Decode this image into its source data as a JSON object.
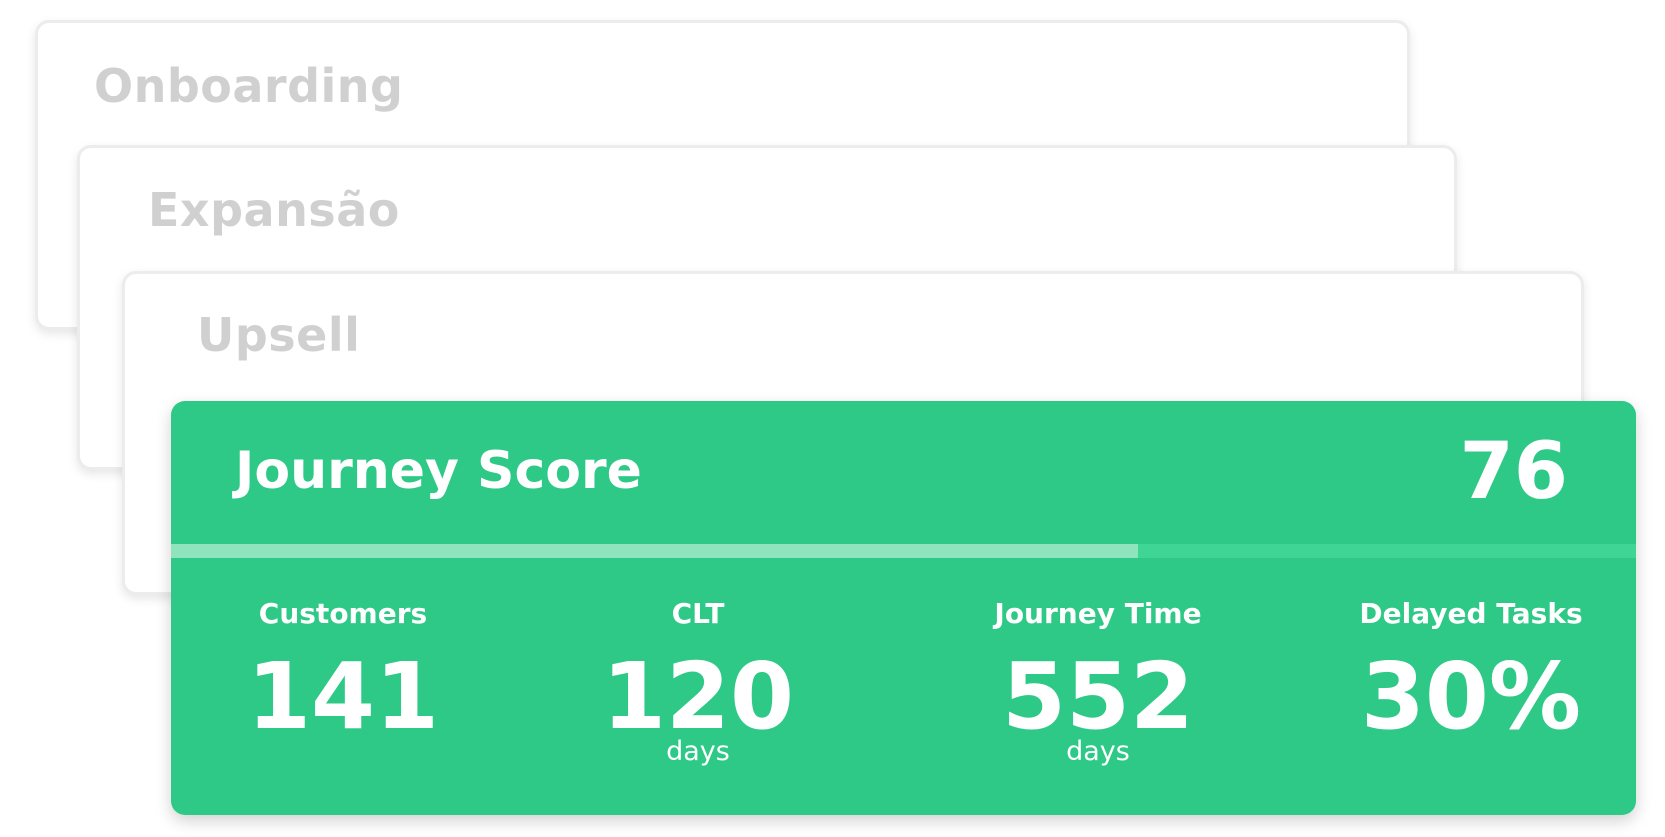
{
  "stack": {
    "cards": [
      {
        "title": "Onboarding"
      },
      {
        "title": "Expansão"
      },
      {
        "title": "Upsell"
      }
    ]
  },
  "score_card": {
    "title": "Journey Score",
    "value": "76",
    "progress": 0.66,
    "colors": {
      "background": "#2ec987",
      "progress_track": "#3fd595",
      "progress_fill": "#8fe3bd",
      "text": "#ffffff"
    },
    "metrics": [
      {
        "label": "Customers",
        "value": "141",
        "unit": ""
      },
      {
        "label": "CLT",
        "value": "120",
        "unit": "days"
      },
      {
        "label": "Journey Time",
        "value": "552",
        "unit": "days"
      },
      {
        "label": "Delayed Tasks",
        "value": "30%",
        "unit": ""
      }
    ]
  }
}
